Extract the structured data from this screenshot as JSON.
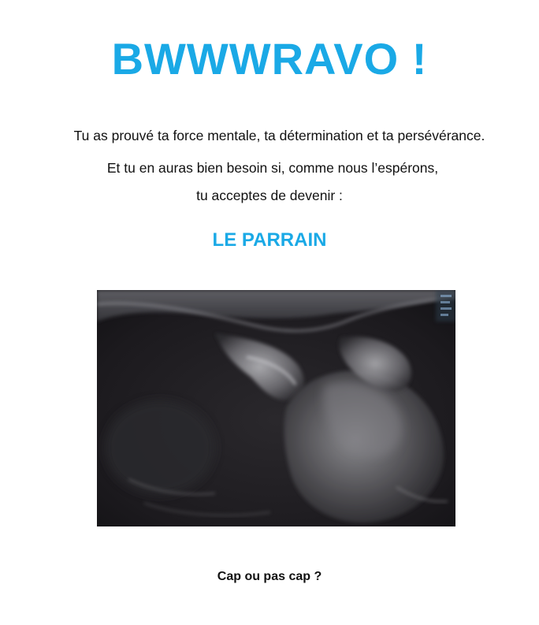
{
  "header": {
    "title": "BWWWRAVO !"
  },
  "message": {
    "line1": "Tu as prouvé ta force mentale, ta détermination et ta persévérance.",
    "line2": "Et tu en auras  bien besoin si, comme nous l’espérons,",
    "line3": "tu acceptes de devenir :"
  },
  "role": {
    "label": "LE PARRAIN"
  },
  "photo": {
    "subject": "ultrasound-scan"
  },
  "footer": {
    "question": "Cap ou pas cap ?"
  },
  "colors": {
    "accent": "#1aa9e6",
    "text": "#111111",
    "background": "#ffffff"
  }
}
